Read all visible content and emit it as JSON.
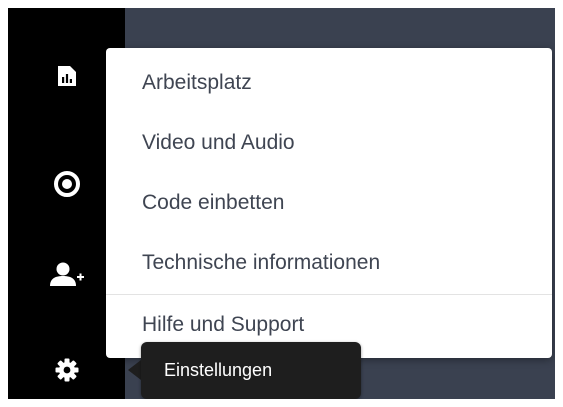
{
  "sidebar": {
    "icons": [
      {
        "name": "report-chart-icon"
      },
      {
        "name": "record-icon"
      },
      {
        "name": "add-user-icon"
      },
      {
        "name": "gear-icon"
      }
    ]
  },
  "menu": {
    "items": [
      {
        "label": "Arbeitsplatz"
      },
      {
        "label": "Video und Audio"
      },
      {
        "label": "Code einbetten"
      },
      {
        "label": "Technische informationen"
      },
      {
        "label": "Hilfe und Support"
      }
    ]
  },
  "tooltip": {
    "text": "Einstellungen"
  },
  "colors": {
    "sidebar_bg": "#000000",
    "content_bg": "#3a4150",
    "menu_bg": "#ffffff",
    "menu_text": "#3f4552",
    "tooltip_bg": "#1e1e1e",
    "tooltip_text": "#ffffff"
  }
}
